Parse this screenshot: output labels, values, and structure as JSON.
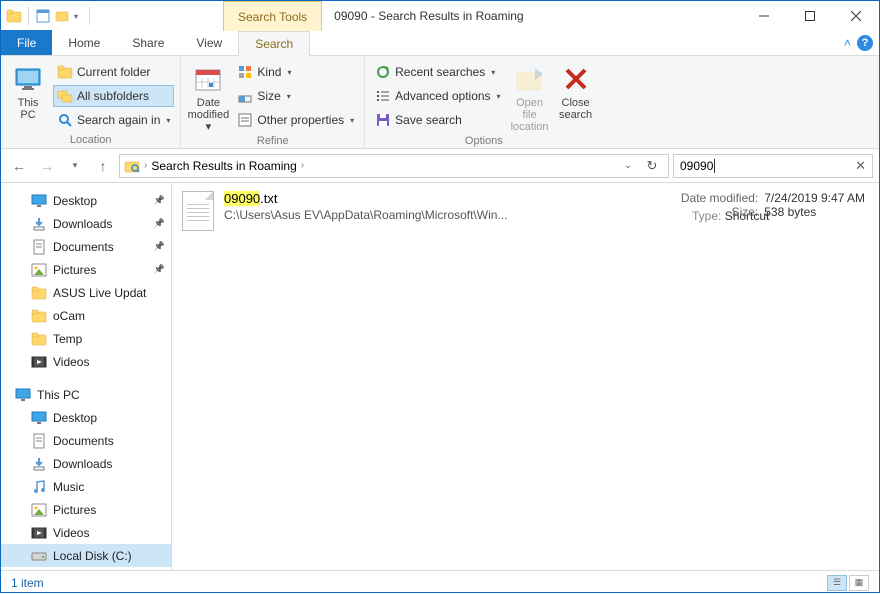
{
  "window": {
    "title": "09090 - Search Results in Roaming",
    "context_tab": "Search Tools"
  },
  "tabs": {
    "file": "File",
    "home": "Home",
    "share": "Share",
    "view": "View",
    "search": "Search"
  },
  "ribbon": {
    "location": {
      "this_pc": "This\nPC",
      "current_folder": "Current folder",
      "all_subfolders": "All subfolders",
      "search_again": "Search again in",
      "label": "Location"
    },
    "refine": {
      "date_modified": "Date\nmodified",
      "kind": "Kind",
      "size": "Size",
      "other_properties": "Other properties",
      "label": "Refine"
    },
    "options": {
      "recent_searches": "Recent searches",
      "advanced_options": "Advanced options",
      "save_search": "Save search",
      "open_file_location": "Open file\nlocation",
      "close_search": "Close\nsearch",
      "label": "Options"
    }
  },
  "address": {
    "path": "Search Results in Roaming",
    "search_value": "09090"
  },
  "tree": {
    "quick": [
      {
        "label": "Desktop",
        "icon": "desktop",
        "pinned": true
      },
      {
        "label": "Downloads",
        "icon": "downloads",
        "pinned": true
      },
      {
        "label": "Documents",
        "icon": "documents",
        "pinned": true
      },
      {
        "label": "Pictures",
        "icon": "pictures",
        "pinned": true
      },
      {
        "label": "ASUS Live Updat",
        "icon": "folder"
      },
      {
        "label": "oCam",
        "icon": "folder"
      },
      {
        "label": "Temp",
        "icon": "folder"
      },
      {
        "label": "Videos",
        "icon": "videos"
      }
    ],
    "this_pc_label": "This PC",
    "this_pc": [
      {
        "label": "Desktop",
        "icon": "desktop"
      },
      {
        "label": "Documents",
        "icon": "documents"
      },
      {
        "label": "Downloads",
        "icon": "downloads"
      },
      {
        "label": "Music",
        "icon": "music"
      },
      {
        "label": "Pictures",
        "icon": "pictures"
      },
      {
        "label": "Videos",
        "icon": "videos"
      },
      {
        "label": "Local Disk (C:)",
        "icon": "drive"
      }
    ]
  },
  "result": {
    "name_hl": "09090",
    "name_ext": ".txt",
    "path": "C:\\Users\\Asus EV\\AppData\\Roaming\\Microsoft\\Win...",
    "type_label": "Type:",
    "type_value": "Shortcut",
    "date_label": "Date modified:",
    "date_value": "7/24/2019 9:47 AM",
    "size_label": "Size:",
    "size_value": "538 bytes"
  },
  "status": {
    "count": "1 item"
  }
}
